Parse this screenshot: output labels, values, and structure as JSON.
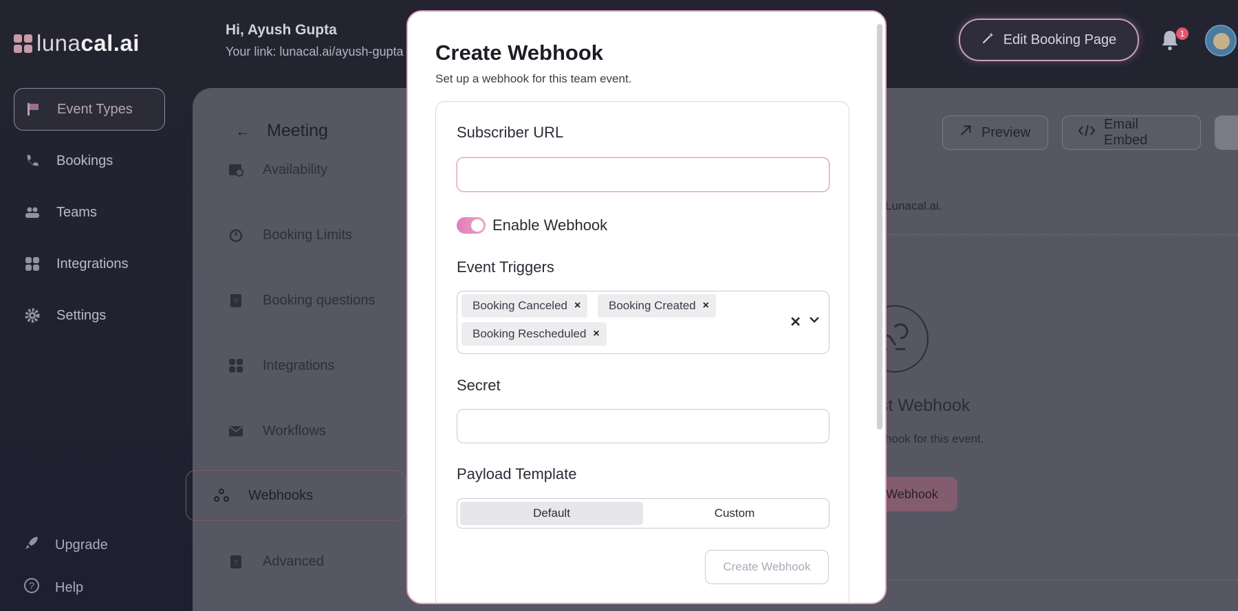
{
  "app": {
    "logo_text_light": "luna",
    "logo_text_bold": "cal.ai",
    "greeting": "Hi, Ayush Gupta",
    "link_text": "Your link: lunacal.ai/ayush-gupta",
    "edit_button": "Edit Booking Page",
    "notification_count": "1"
  },
  "sidebar": {
    "items": [
      {
        "label": "Event Types",
        "icon": "flag-icon"
      },
      {
        "label": "Bookings",
        "icon": "phone-icon"
      },
      {
        "label": "Teams",
        "icon": "users-icon"
      },
      {
        "label": "Integrations",
        "icon": "grid-icon"
      },
      {
        "label": "Settings",
        "icon": "gear-icon"
      }
    ],
    "bottom": [
      {
        "label": "Upgrade",
        "icon": "rocket-icon"
      },
      {
        "label": "Help",
        "icon": "help-icon"
      }
    ]
  },
  "event": {
    "title": "Meeting",
    "menu": [
      {
        "label": "Availability"
      },
      {
        "label": "Booking Limits"
      },
      {
        "label": "Booking questions"
      },
      {
        "label": "Integrations"
      },
      {
        "label": "Workflows"
      },
      {
        "label": "Webhooks"
      },
      {
        "label": "Advanced"
      }
    ],
    "actions": {
      "preview": "Preview",
      "email_embed": "Email Embed"
    },
    "webhooks_hint": "s in Lunacal.ai.",
    "empty_title": "first Webhook",
    "empty_sub": "ebhook for this event.",
    "new_button": "Webhook"
  },
  "modal": {
    "title": "Create Webhook",
    "subtitle": "Set up a webhook for this team event.",
    "subscriber_label": "Subscriber URL",
    "subscriber_value": "",
    "enable_label": "Enable Webhook",
    "enable_on": true,
    "triggers_label": "Event Triggers",
    "triggers": [
      "Booking Canceled",
      "Booking Created",
      "Booking Rescheduled"
    ],
    "secret_label": "Secret",
    "secret_value": "",
    "payload_label": "Payload Template",
    "payload_options": [
      "Default",
      "Custom"
    ],
    "payload_selected": "Default",
    "create_button": "Create Webhook"
  }
}
